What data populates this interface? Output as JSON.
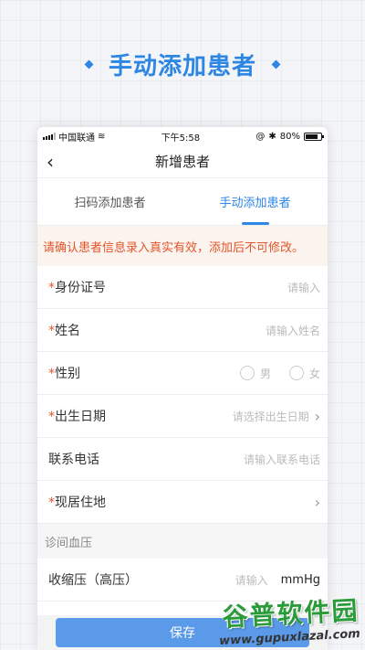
{
  "headline": "手动添加患者",
  "status_bar": {
    "carrier": "中国联通",
    "time": "下午5:58",
    "battery": "80%",
    "battery_level": 0.8
  },
  "nav": {
    "title": "新增患者"
  },
  "tabs": [
    {
      "label": "扫码添加患者",
      "active": false
    },
    {
      "label": "手动添加患者",
      "active": true
    }
  ],
  "notice": "请确认患者信息录入真实有效，添加后不可修改。",
  "form": {
    "id_card": {
      "required": "*",
      "label": "身份证号",
      "placeholder": "请输入"
    },
    "name": {
      "required": "*",
      "label": "姓名",
      "placeholder": "请输入姓名"
    },
    "gender": {
      "required": "*",
      "label": "性别",
      "male": "男",
      "female": "女"
    },
    "birthdate": {
      "required": "*",
      "label": "出生日期",
      "placeholder": "请选择出生日期"
    },
    "phone": {
      "label": "联系电话",
      "placeholder": "请输入联系电话"
    },
    "address": {
      "required": "*",
      "label": "现居住地"
    },
    "section_bp": "诊间血压",
    "systolic": {
      "label": "收缩压（高压）",
      "placeholder": "请输入",
      "unit": "mmHg"
    }
  },
  "footer": {
    "save_label": "保存"
  },
  "watermark": {
    "brand": "谷普软件园",
    "url": "www.gupuxlazal.com"
  },
  "colors": {
    "accent": "#2d86e3",
    "warning": "#e3562b"
  }
}
